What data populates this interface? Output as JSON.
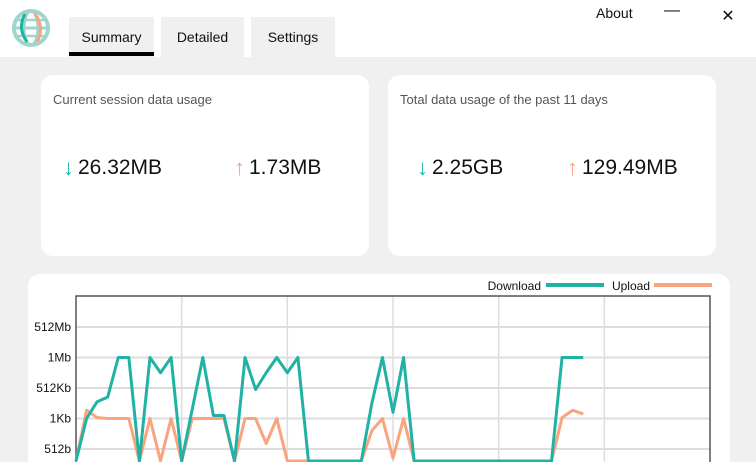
{
  "colors": {
    "download": "#20b2a4",
    "upload": "#f9a47e"
  },
  "header": {
    "logo": "globe-logo-icon",
    "tabs": [
      {
        "label": "Summary",
        "active": true
      },
      {
        "label": "Detailed",
        "active": false
      },
      {
        "label": "Settings",
        "active": false
      }
    ],
    "about_label": "About",
    "minimize_icon": "minimize-icon",
    "close_icon": "close-icon"
  },
  "cards": [
    {
      "title": "Current session data usage",
      "download": "26.32MB",
      "upload": "1.73MB"
    },
    {
      "title": "Total data usage of the past 11 days",
      "download": "2.25GB",
      "upload": "129.49MB"
    }
  ],
  "chart_data": {
    "type": "line",
    "legend": [
      "Download",
      "Upload"
    ],
    "legend_position": "top-right",
    "yticks": [
      "512b",
      "1Kb",
      "512Kb",
      "1Mb",
      "512Mb"
    ],
    "ytick_levels": [
      0,
      1,
      2,
      3,
      4
    ],
    "ylim": [
      -1.5,
      4.5
    ],
    "xlim": [
      0,
      60
    ],
    "x_gridlines": [
      10,
      20,
      30,
      40,
      50
    ],
    "series": [
      {
        "name": "Download",
        "points": [
          [
            0,
            -1
          ],
          [
            1,
            1
          ],
          [
            2,
            1.55
          ],
          [
            3,
            1.7
          ],
          [
            4,
            3
          ],
          [
            5,
            3
          ],
          [
            6,
            -1
          ],
          [
            7,
            3
          ],
          [
            8,
            2.5
          ],
          [
            9,
            3
          ],
          [
            10,
            -1
          ],
          [
            11,
            1.3
          ],
          [
            12,
            3
          ],
          [
            13,
            1.1
          ],
          [
            14,
            1.1
          ],
          [
            15,
            -1
          ],
          [
            16,
            3
          ],
          [
            17,
            1.95
          ],
          [
            18,
            2.5
          ],
          [
            19,
            3
          ],
          [
            20,
            2.5
          ],
          [
            21,
            3
          ],
          [
            22,
            -1
          ],
          [
            27,
            -1
          ],
          [
            28,
            1.5
          ],
          [
            29,
            3
          ],
          [
            30,
            1.2
          ],
          [
            31,
            3
          ],
          [
            32,
            -1
          ],
          [
            45,
            -1
          ],
          [
            46,
            3
          ],
          [
            47,
            3
          ],
          [
            48,
            3
          ]
        ]
      },
      {
        "name": "Upload",
        "points": [
          [
            0,
            -1
          ],
          [
            1,
            1.27
          ],
          [
            2,
            1.03
          ],
          [
            3,
            1
          ],
          [
            4,
            1
          ],
          [
            5,
            1
          ],
          [
            6,
            -1
          ],
          [
            7,
            1
          ],
          [
            8,
            -0.5
          ],
          [
            9,
            1
          ],
          [
            10,
            -1
          ],
          [
            11,
            1
          ],
          [
            12,
            1
          ],
          [
            13,
            1
          ],
          [
            14,
            1
          ],
          [
            15,
            -1
          ],
          [
            16,
            1
          ],
          [
            17,
            1
          ],
          [
            18,
            0.18
          ],
          [
            19,
            1
          ],
          [
            20,
            -1
          ],
          [
            27,
            -1
          ],
          [
            28,
            0.6
          ],
          [
            29,
            1
          ],
          [
            30,
            -0.3
          ],
          [
            31,
            1
          ],
          [
            32,
            -1
          ],
          [
            45,
            -1
          ],
          [
            46,
            1.03
          ],
          [
            47,
            1.27
          ],
          [
            48,
            1.15
          ]
        ]
      }
    ]
  }
}
